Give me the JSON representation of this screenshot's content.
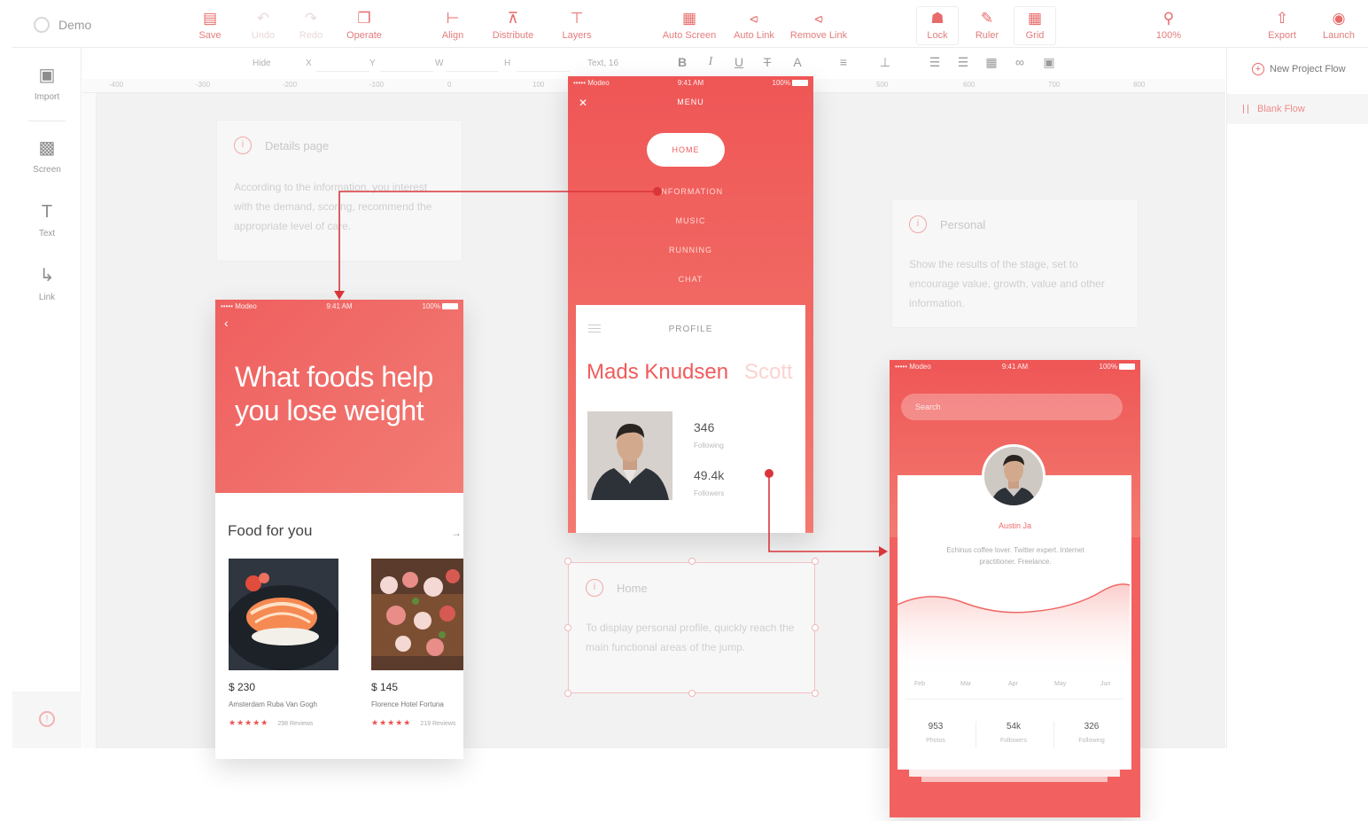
{
  "app": {
    "name": "Demo"
  },
  "toolbar": {
    "save": "Save",
    "undo": "Undo",
    "redo": "Redo",
    "operate": "Operate",
    "align": "Align",
    "distribute": "Distribute",
    "layers": "Layers",
    "auto_screen": "Auto Screen",
    "auto_link": "Auto Link",
    "remove_link": "Remove Link",
    "lock": "Lock",
    "ruler": "Ruler",
    "grid": "Grid",
    "zoom": "100%",
    "export": "Export",
    "launch": "Launch"
  },
  "left_tools": {
    "import": "Import",
    "screen": "Screen",
    "text": "Text",
    "link": "Link"
  },
  "propbar": {
    "hide": "Hide",
    "x": "X",
    "y": "Y",
    "w": "W",
    "h": "H",
    "text_size": "Text, 16"
  },
  "ruler": {
    "ticks": [
      "-400",
      "-300",
      "-200",
      "-100",
      "0",
      "100",
      "200",
      "300",
      "400",
      "500",
      "600",
      "700",
      "800"
    ]
  },
  "right_panel": {
    "new_flow": "New Project Flow",
    "blank_flow": "Blank Flow"
  },
  "notes": {
    "a": {
      "title": "Details page",
      "body": "According to the information, you interest with the demand, scoring, recommend the appropriate level of care."
    },
    "b": {
      "title": "Personal",
      "body": "Show the results of the stage, set to encourage value, growth, value and other information."
    },
    "c": {
      "title": "Home",
      "body": "To display personal profile, quickly reach the main functional areas of the jump."
    }
  },
  "status_bar": {
    "carrier": "••••• Modeo",
    "time": "9:41 AM",
    "battery": "100%"
  },
  "screen_food": {
    "headline": "What foods help you lose weight",
    "section": "Food for you",
    "more": "→",
    "items": [
      {
        "price": "$ 230",
        "name": "Amsterdam Ruba Van Gogh",
        "stars": "★★★★★",
        "reviews": "298 Reviews"
      },
      {
        "price": "$ 145",
        "name": "Florence Hotel Fortuna",
        "stars": "★★★★★",
        "reviews": "219 Reviews"
      }
    ]
  },
  "screen_menu": {
    "title": "MENU",
    "home": "HOME",
    "items": [
      "INFORMATION",
      "MUSIC",
      "RUNNING",
      "CHAT"
    ],
    "profile_title": "PROFILE",
    "name": "Mads Knudsen",
    "name_faded": "Scott",
    "stats": [
      {
        "num": "346",
        "label": "Following"
      },
      {
        "num": "49.4k",
        "label": "Followers"
      }
    ]
  },
  "screen_profile": {
    "search": "Search",
    "name": "Austin Ja",
    "bio": "Echinus coffee lover. Twitter expert. Internet practitioner. Freelance.",
    "months": [
      "Feb",
      "Mar",
      "Apr",
      "May",
      "Jun"
    ],
    "stats": [
      {
        "num": "953",
        "label": "Photos"
      },
      {
        "num": "54k",
        "label": "Followers"
      },
      {
        "num": "326",
        "label": "Following"
      }
    ]
  },
  "colors": {
    "accent": "#ef5b5b",
    "accent_light": "#f37a70",
    "canvas": "#f2f2f2"
  }
}
